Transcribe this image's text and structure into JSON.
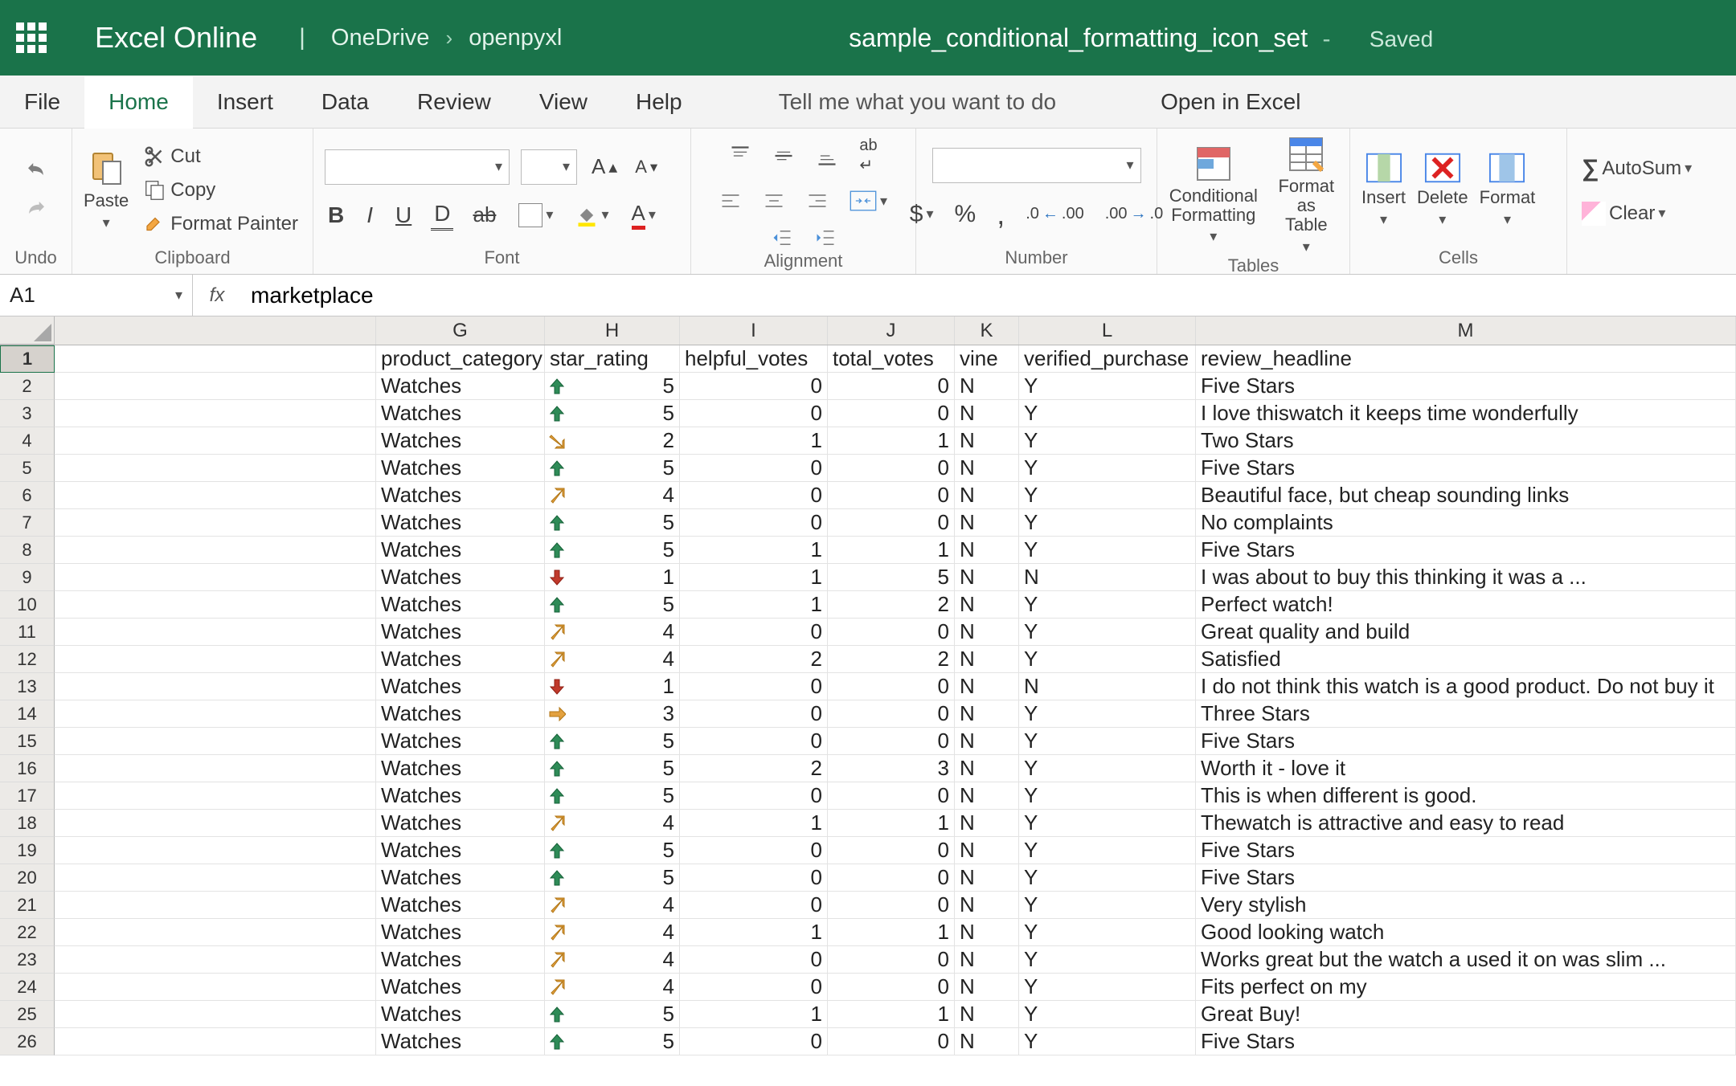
{
  "title": {
    "brand": "Excel Online",
    "breadcrumb": [
      "OneDrive",
      "openpyxl"
    ],
    "filename": "sample_conditional_formatting_icon_set",
    "status": "Saved"
  },
  "menu": {
    "items": [
      "File",
      "Home",
      "Insert",
      "Data",
      "Review",
      "View",
      "Help"
    ],
    "active": "Home",
    "tellme": "Tell me what you want to do",
    "openin": "Open in Excel"
  },
  "ribbon": {
    "undo": "Undo",
    "paste": "Paste",
    "cut": "Cut",
    "copy": "Copy",
    "fpainter": "Format Painter",
    "clipboard": "Clipboard",
    "font": "Font",
    "alignment": "Alignment",
    "number": "Number",
    "tables": "Tables",
    "cells": "Cells",
    "condfmt": "Conditional Formatting",
    "fmttable": "Format as Table",
    "insert": "Insert",
    "delete": "Delete",
    "format": "Format",
    "autosum": "AutoSum",
    "clear": "Clear"
  },
  "fbar": {
    "ref": "A1",
    "value": "marketplace"
  },
  "columns": [
    {
      "letter": "",
      "class": "colw-blank"
    },
    {
      "letter": "G",
      "class": "colw-G"
    },
    {
      "letter": "H",
      "class": "colw-H"
    },
    {
      "letter": "I",
      "class": "colw-I"
    },
    {
      "letter": "J",
      "class": "colw-J"
    },
    {
      "letter": "K",
      "class": "colw-K"
    },
    {
      "letter": "L",
      "class": "colw-L"
    },
    {
      "letter": "M",
      "class": "colw-M"
    }
  ],
  "headers": {
    "G": "product_category",
    "H": "star_rating",
    "I": "helpful_votes",
    "J": "total_votes",
    "K": "vine",
    "L": "verified_purchase",
    "M": "review_headline"
  },
  "rows": [
    {
      "n": 2,
      "G": "Watches",
      "H": 5,
      "icon": "up",
      "I": 0,
      "J": 0,
      "K": "N",
      "L": "Y",
      "M": "Five Stars"
    },
    {
      "n": 3,
      "G": "Watches",
      "H": 5,
      "icon": "up",
      "I": 0,
      "J": 0,
      "K": "N",
      "L": "Y",
      "M": "I love thiswatch it keeps time wonderfully"
    },
    {
      "n": 4,
      "G": "Watches",
      "H": 2,
      "icon": "diagdown",
      "I": 1,
      "J": 1,
      "K": "N",
      "L": "Y",
      "M": "Two Stars"
    },
    {
      "n": 5,
      "G": "Watches",
      "H": 5,
      "icon": "up",
      "I": 0,
      "J": 0,
      "K": "N",
      "L": "Y",
      "M": "Five Stars"
    },
    {
      "n": 6,
      "G": "Watches",
      "H": 4,
      "icon": "diagup",
      "I": 0,
      "J": 0,
      "K": "N",
      "L": "Y",
      "M": "Beautiful face, but cheap sounding links"
    },
    {
      "n": 7,
      "G": "Watches",
      "H": 5,
      "icon": "up",
      "I": 0,
      "J": 0,
      "K": "N",
      "L": "Y",
      "M": "No complaints"
    },
    {
      "n": 8,
      "G": "Watches",
      "H": 5,
      "icon": "up",
      "I": 1,
      "J": 1,
      "K": "N",
      "L": "Y",
      "M": "Five Stars"
    },
    {
      "n": 9,
      "G": "Watches",
      "H": 1,
      "icon": "down",
      "I": 1,
      "J": 5,
      "K": "N",
      "L": "N",
      "M": "I was about to buy this thinking it was a ..."
    },
    {
      "n": 10,
      "G": "Watches",
      "H": 5,
      "icon": "up",
      "I": 1,
      "J": 2,
      "K": "N",
      "L": "Y",
      "M": "Perfect watch!"
    },
    {
      "n": 11,
      "G": "Watches",
      "H": 4,
      "icon": "diagup",
      "I": 0,
      "J": 0,
      "K": "N",
      "L": "Y",
      "M": "Great quality and build"
    },
    {
      "n": 12,
      "G": "Watches",
      "H": 4,
      "icon": "diagup",
      "I": 2,
      "J": 2,
      "K": "N",
      "L": "Y",
      "M": "Satisfied"
    },
    {
      "n": 13,
      "G": "Watches",
      "H": 1,
      "icon": "down",
      "I": 0,
      "J": 0,
      "K": "N",
      "L": "N",
      "M": "I do not think this watch is a good product. Do not buy it"
    },
    {
      "n": 14,
      "G": "Watches",
      "H": 3,
      "icon": "flat",
      "I": 0,
      "J": 0,
      "K": "N",
      "L": "Y",
      "M": "Three Stars"
    },
    {
      "n": 15,
      "G": "Watches",
      "H": 5,
      "icon": "up",
      "I": 0,
      "J": 0,
      "K": "N",
      "L": "Y",
      "M": "Five Stars"
    },
    {
      "n": 16,
      "G": "Watches",
      "H": 5,
      "icon": "up",
      "I": 2,
      "J": 3,
      "K": "N",
      "L": "Y",
      "M": "Worth it - love it"
    },
    {
      "n": 17,
      "G": "Watches",
      "H": 5,
      "icon": "up",
      "I": 0,
      "J": 0,
      "K": "N",
      "L": "Y",
      "M": "This is when different is good."
    },
    {
      "n": 18,
      "G": "Watches",
      "H": 4,
      "icon": "diagup",
      "I": 1,
      "J": 1,
      "K": "N",
      "L": "Y",
      "M": "Thewatch is attractive and easy to read"
    },
    {
      "n": 19,
      "G": "Watches",
      "H": 5,
      "icon": "up",
      "I": 0,
      "J": 0,
      "K": "N",
      "L": "Y",
      "M": "Five Stars"
    },
    {
      "n": 20,
      "G": "Watches",
      "H": 5,
      "icon": "up",
      "I": 0,
      "J": 0,
      "K": "N",
      "L": "Y",
      "M": "Five Stars"
    },
    {
      "n": 21,
      "G": "Watches",
      "H": 4,
      "icon": "diagup",
      "I": 0,
      "J": 0,
      "K": "N",
      "L": "Y",
      "M": "Very stylish"
    },
    {
      "n": 22,
      "G": "Watches",
      "H": 4,
      "icon": "diagup",
      "I": 1,
      "J": 1,
      "K": "N",
      "L": "Y",
      "M": "Good looking watch"
    },
    {
      "n": 23,
      "G": "Watches",
      "H": 4,
      "icon": "diagup",
      "I": 0,
      "J": 0,
      "K": "N",
      "L": "Y",
      "M": "Works great but the watch a used it on was slim ..."
    },
    {
      "n": 24,
      "G": "Watches",
      "H": 4,
      "icon": "diagup",
      "I": 0,
      "J": 0,
      "K": "N",
      "L": "Y",
      "M": "Fits perfect on my"
    },
    {
      "n": 25,
      "G": "Watches",
      "H": 5,
      "icon": "up",
      "I": 1,
      "J": 1,
      "K": "N",
      "L": "Y",
      "M": "Great Buy!"
    },
    {
      "n": 26,
      "G": "Watches",
      "H": 5,
      "icon": "up",
      "I": 0,
      "J": 0,
      "K": "N",
      "L": "Y",
      "M": "Five Stars"
    }
  ]
}
